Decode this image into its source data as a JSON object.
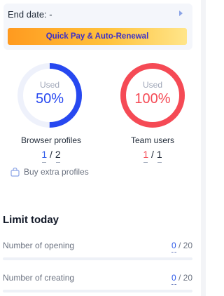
{
  "plan": {
    "end_date_label": "End date: -",
    "quick_pay_label": "Quick Pay & Auto-Renewal"
  },
  "gauges": [
    {
      "id": "browser-profiles",
      "used_label": "Used",
      "percent_text": "50%",
      "percent": 50,
      "color": "#2748f0",
      "track_color": "#eef1fb",
      "label": "Browser profiles",
      "used": "1",
      "separator": "/",
      "total": "2",
      "used_color": "#2f5bea"
    },
    {
      "id": "team-users",
      "used_label": "Used",
      "percent_text": "100%",
      "percent": 100,
      "color": "#f54a55",
      "track_color": "#fde8ea",
      "label": "Team users",
      "used": "1",
      "separator": "/",
      "total": "1",
      "used_color": "#f54a55"
    }
  ],
  "buy_extra": {
    "label": "Buy extra profiles",
    "icon": "shopping-bag-icon"
  },
  "limit_today": {
    "title": "Limit today",
    "rows": [
      {
        "name": "Number of opening",
        "used": "0",
        "total": "/ 20"
      },
      {
        "name": "Number of creating",
        "used": "0",
        "total": "/ 20"
      }
    ]
  }
}
